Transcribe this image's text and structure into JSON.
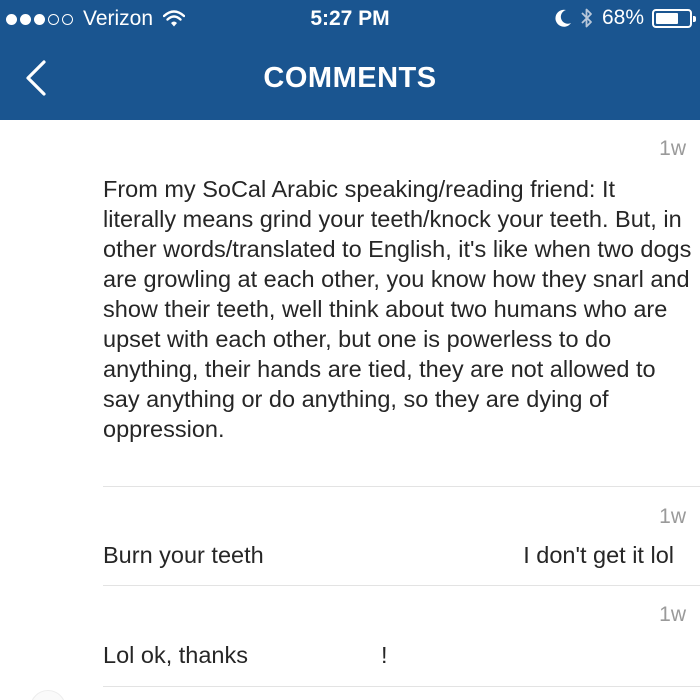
{
  "status_bar": {
    "carrier": "Verizon",
    "time": "5:27 PM",
    "battery": "68%",
    "battery_level": 0.68,
    "signal_dots_filled": 3,
    "signal_dots_total": 5
  },
  "header": {
    "title": "COMMENTS",
    "background_color": "#1a5590"
  },
  "comments": [
    {
      "timestamp": "1w",
      "text": "From my SoCal Arabic speaking/reading friend: It literally means grind your teeth/knock your teeth.  But, in other words/translated to English, it's like when two dogs are growling at each other, you know how they snarl and show their teeth, well think about two humans who are upset with each other, but one is powerless to do anything, their hands are tied, they are not allowed to say anything or do anything, so they are dying of oppression."
    },
    {
      "timestamp": "1w",
      "text": "Burn your teeth",
      "text_right": "I don't get it lol"
    },
    {
      "timestamp": "1w",
      "text": "Lol ok, thanks",
      "text_right": "!"
    }
  ]
}
